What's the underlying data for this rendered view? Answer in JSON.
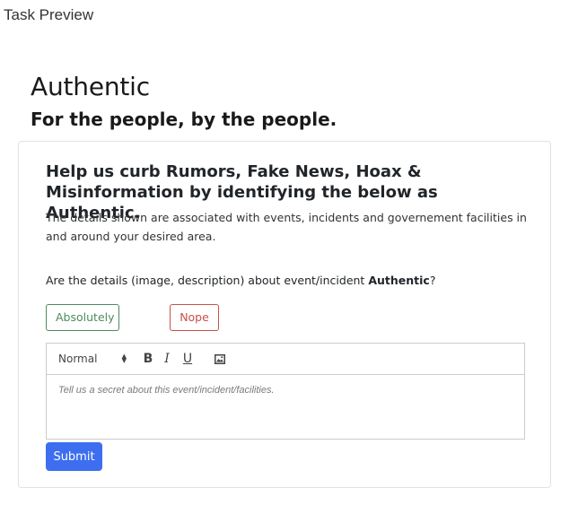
{
  "window": {
    "title": "Task Preview"
  },
  "header": {
    "title": "Authentic",
    "tagline": "For the people, by the people."
  },
  "card": {
    "headline_prefix": "Help us curb Rumors, Fake News, Hoax & Misinformation by identifying the below as ",
    "headline_emphasis": "Authentic",
    "headline_suffix": ".",
    "details": "The details shown are associated with events, incidents and governement facilities in and around your desired area.",
    "question_prefix": "Are the details (image, description) about event/incident ",
    "question_emphasis": "Authentic",
    "question_suffix": "?",
    "answers": {
      "yes_label": "Absolutely",
      "no_label": "Nope"
    },
    "editor": {
      "format_value": "Normal",
      "bold_label": "B",
      "italic_label": "I",
      "underline_label": "U",
      "image_icon": "image-icon",
      "placeholder": "Tell us a secret about this event/incident/facilities."
    },
    "submit_label": "Submit"
  },
  "colors": {
    "yes_outline": "#4e8a5e",
    "no_outline": "#c9504a",
    "primary": "#3d6ef0",
    "border": "#dee2e6"
  }
}
